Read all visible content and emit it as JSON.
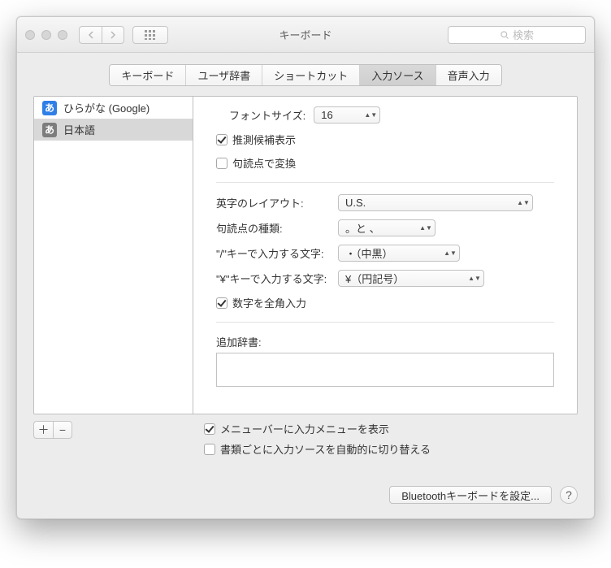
{
  "window": {
    "title": "キーボード"
  },
  "toolbar": {
    "search_placeholder": "検索"
  },
  "tabs": [
    {
      "label": "キーボード",
      "selected": false
    },
    {
      "label": "ユーザ辞書",
      "selected": false
    },
    {
      "label": "ショートカット",
      "selected": false
    },
    {
      "label": "入力ソース",
      "selected": true
    },
    {
      "label": "音声入力",
      "selected": false
    }
  ],
  "sources": [
    {
      "icon_letter": "あ",
      "color": "blue",
      "label": "ひらがな (Google)",
      "selected": false
    },
    {
      "icon_letter": "あ",
      "color": "gray",
      "label": "日本語",
      "selected": true
    }
  ],
  "settings": {
    "font_size_label": "フォントサイズ:",
    "font_size_value": "16",
    "show_suggestions": {
      "label": "推測候補表示",
      "checked": true
    },
    "convert_punct": {
      "label": "句読点で変換",
      "checked": false
    },
    "romaji_layout_label": "英字のレイアウト:",
    "romaji_layout_value": "U.S.",
    "punct_type_label": "句読点の種類:",
    "punct_type_value": "。と 、",
    "slash_label": "\"/\"キーで入力する文字:",
    "slash_value": "・（中黒）",
    "yen_label": "\"¥\"キーで入力する文字:",
    "yen_value": "¥（円記号）",
    "fullwidth_digits": {
      "label": "数字を全角入力",
      "checked": true
    },
    "extra_dict_label": "追加辞書:"
  },
  "global": {
    "show_menu": {
      "label": "メニューバーに入力メニューを表示",
      "checked": true
    },
    "auto_switch": {
      "label": "書類ごとに入力ソースを自動的に切り替える",
      "checked": false
    }
  },
  "buttons": {
    "bluetooth": "Bluetoothキーボードを設定..."
  }
}
